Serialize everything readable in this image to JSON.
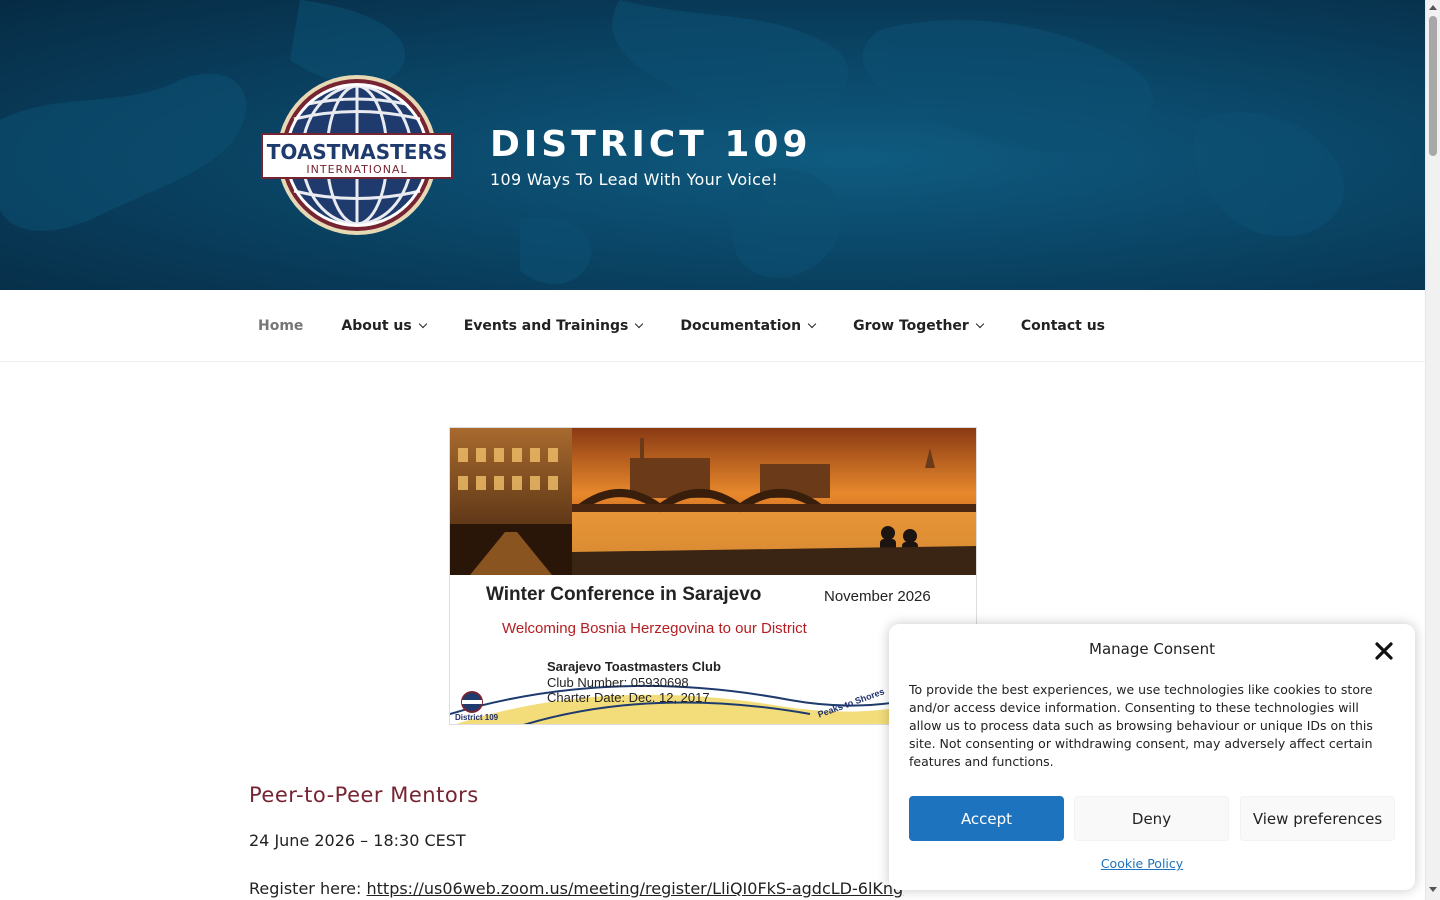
{
  "header": {
    "logo_line1": "TOASTMASTERS",
    "logo_line2": "INTERNATIONAL",
    "site_title": "DISTRICT 109",
    "tagline": "109 Ways To Lead With Your Voice!"
  },
  "nav": {
    "items": [
      {
        "label": "Home",
        "active": true,
        "has_dropdown": false
      },
      {
        "label": "About us",
        "active": false,
        "has_dropdown": true
      },
      {
        "label": "Events and Trainings",
        "active": false,
        "has_dropdown": true
      },
      {
        "label": "Documentation",
        "active": false,
        "has_dropdown": true
      },
      {
        "label": "Grow Together",
        "active": false,
        "has_dropdown": true
      },
      {
        "label": "Contact us",
        "active": false,
        "has_dropdown": false
      }
    ]
  },
  "banner": {
    "title": "Winter Conference in Sarajevo",
    "date": "November 2026",
    "welcome": "Welcoming Bosnia Herzegovina to our District",
    "club_name": "Sarajevo Toastmasters Club",
    "club_number": "Club Number: 05930698",
    "charter_date": "Charter Date: Dec. 12, 2017",
    "district": "District 109",
    "slogan": "Peaks to Shores"
  },
  "post": {
    "title": "Peer-to-Peer Mentors",
    "date": "24 June 2026 – 18:30 CEST",
    "register_label": "Register here: ",
    "register_url": "https://us06web.zoom.us/meeting/register/LliQI0FkS-agdcLD-6lKng"
  },
  "consent": {
    "title": "Manage Consent",
    "text": "To provide the best experiences, we use technologies like cookies to store and/or access device information. Consenting to these technologies will allow us to process data such as browsing behaviour or unique IDs on this site. Not consenting or withdrawing consent, may adversely affect certain features and functions.",
    "accept": "Accept",
    "deny": "Deny",
    "preferences": "View preferences",
    "policy_link": "Cookie Policy"
  },
  "colors": {
    "header_bg": "#0a4566",
    "brand_maroon": "#772432",
    "accent_blue": "#1e73be",
    "banner_red": "#b41e22"
  },
  "icons": [
    "toastmasters-globe-logo",
    "chevron-down-icon",
    "close-icon"
  ]
}
